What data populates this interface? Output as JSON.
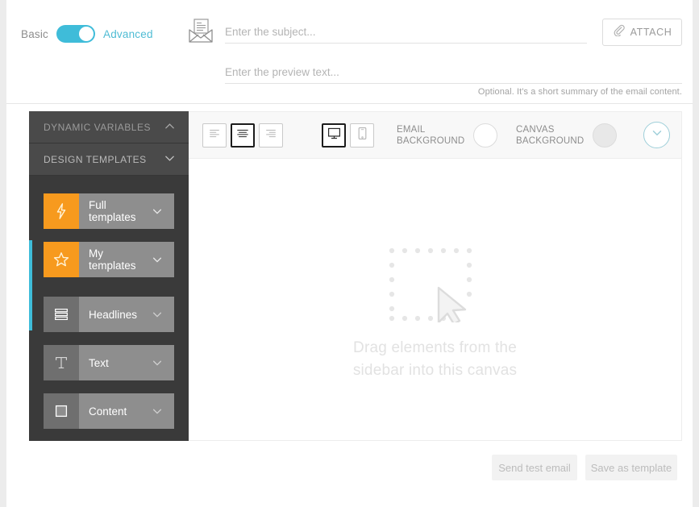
{
  "header": {
    "mode_basic": "Basic",
    "mode_advanced": "Advanced",
    "toggle_state": "advanced",
    "envelope_icon": "envelope-icon",
    "subject_placeholder": "Enter the subject...",
    "subject_value": "",
    "preview_placeholder": "Enter the preview text...",
    "preview_value": "",
    "preview_hint": "Optional. It's a short summary of the email content.",
    "attach_label": "ATTACH",
    "attach_icon": "paperclip-icon"
  },
  "sidebar": {
    "sections": [
      {
        "title": "DYNAMIC VARIABLES",
        "chevron": "chevron-up-icon",
        "expanded": false
      },
      {
        "title": "DESIGN TEMPLATES",
        "chevron": "chevron-down-icon",
        "expanded": true
      }
    ],
    "templates": [
      {
        "label": "Full templates",
        "icon": "lightning-bolt-icon",
        "icon_style": "orange",
        "chevron": "chevron-down-icon"
      },
      {
        "label": "My templates",
        "icon": "star-icon",
        "icon_style": "orange",
        "chevron": "chevron-down-icon"
      },
      {
        "label": "Headlines",
        "icon": "headlines-icon",
        "icon_style": "grey",
        "chevron": "chevron-down-icon"
      },
      {
        "label": "Text",
        "icon": "text-t-icon",
        "icon_style": "grey",
        "chevron": "chevron-down-icon"
      },
      {
        "label": "Content",
        "icon": "content-square-icon",
        "icon_style": "grey",
        "chevron": "chevron-down-icon"
      }
    ]
  },
  "toolbar": {
    "align_buttons": [
      {
        "name": "align-left",
        "icon": "align-left-icon",
        "selected": false
      },
      {
        "name": "align-center",
        "icon": "align-center-icon",
        "selected": true
      },
      {
        "name": "align-right",
        "icon": "align-right-icon",
        "selected": false
      }
    ],
    "device_buttons": [
      {
        "name": "desktop",
        "icon": "desktop-icon",
        "selected": true
      },
      {
        "name": "mobile",
        "icon": "mobile-icon",
        "selected": false
      }
    ],
    "email_background_label_line1": "EMAIL",
    "email_background_label_line2": "BACKGROUND",
    "email_background_color": "#ffffff",
    "canvas_background_label_line1": "CANVAS",
    "canvas_background_label_line2": "BACKGROUND",
    "canvas_background_color": "#e8e8e8",
    "expand_icon": "chevron-down-circle-icon"
  },
  "canvas": {
    "placeholder_icon": "drag-drop-cursor-icon",
    "placeholder_line1": "Drag elements from the",
    "placeholder_line2": "sidebar into this canvas"
  },
  "footer": {
    "send_test_label": "Send test email",
    "save_template_label": "Save as template"
  },
  "colors": {
    "accent_teal": "#3fbcd9",
    "accent_orange": "#f79a1e",
    "sidebar_dark": "#3a3a3a",
    "sidebar_header": "#4a4a4a"
  }
}
